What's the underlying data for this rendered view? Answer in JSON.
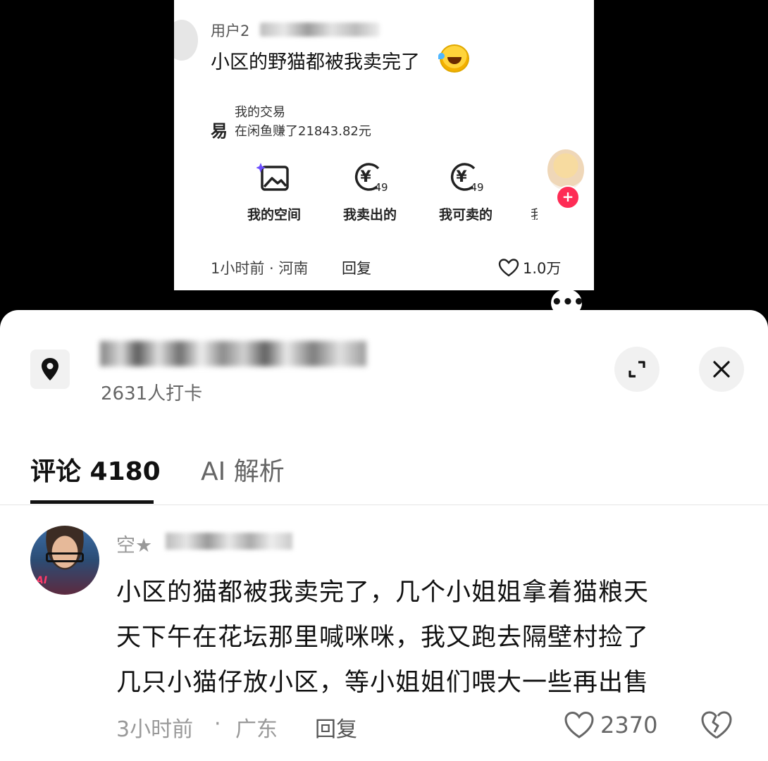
{
  "embedded_post": {
    "user_prefix": "用户2",
    "text": "小区的野猫都被我卖完了",
    "trade_icon": "易",
    "trade_title": "我的交易",
    "trade_desc": "在闲鱼赚了21843.82元",
    "shortcuts": [
      {
        "label": "我的空间",
        "icon": "gallery-icon"
      },
      {
        "label": "我卖出的",
        "icon": "yen-coin-icon",
        "badge": "49"
      },
      {
        "label": "我可卖的",
        "icon": "yen-coin-icon",
        "badge": "49"
      }
    ],
    "cut_label": "我",
    "time_location": "1小时前 · 河南",
    "reply_label": "回复",
    "like_count": "1.0万",
    "more_label": "•••"
  },
  "location": {
    "checkins": "2631人打卡"
  },
  "tabs": [
    {
      "label": "评论 4180",
      "active": true
    },
    {
      "label": "AI 解析",
      "active": false
    }
  ],
  "comment": {
    "user_prefix": "空★",
    "avatar_tag": "AI",
    "lines": [
      "小区的猫都被我卖完了，几个小姐姐拿着猫粮天",
      "天下午在花坛那里喊咪咪，我又跑去隔壁村捡了",
      "几只小猫仔放小区，等小姐姐们喂大一些再出售"
    ],
    "time": "3小时前",
    "sep": "·",
    "region": "广东",
    "reply_label": "回复",
    "like_count": "2370"
  },
  "colors": {
    "accent": "#fe2c55",
    "text_primary": "#111111",
    "text_secondary": "#999999"
  }
}
